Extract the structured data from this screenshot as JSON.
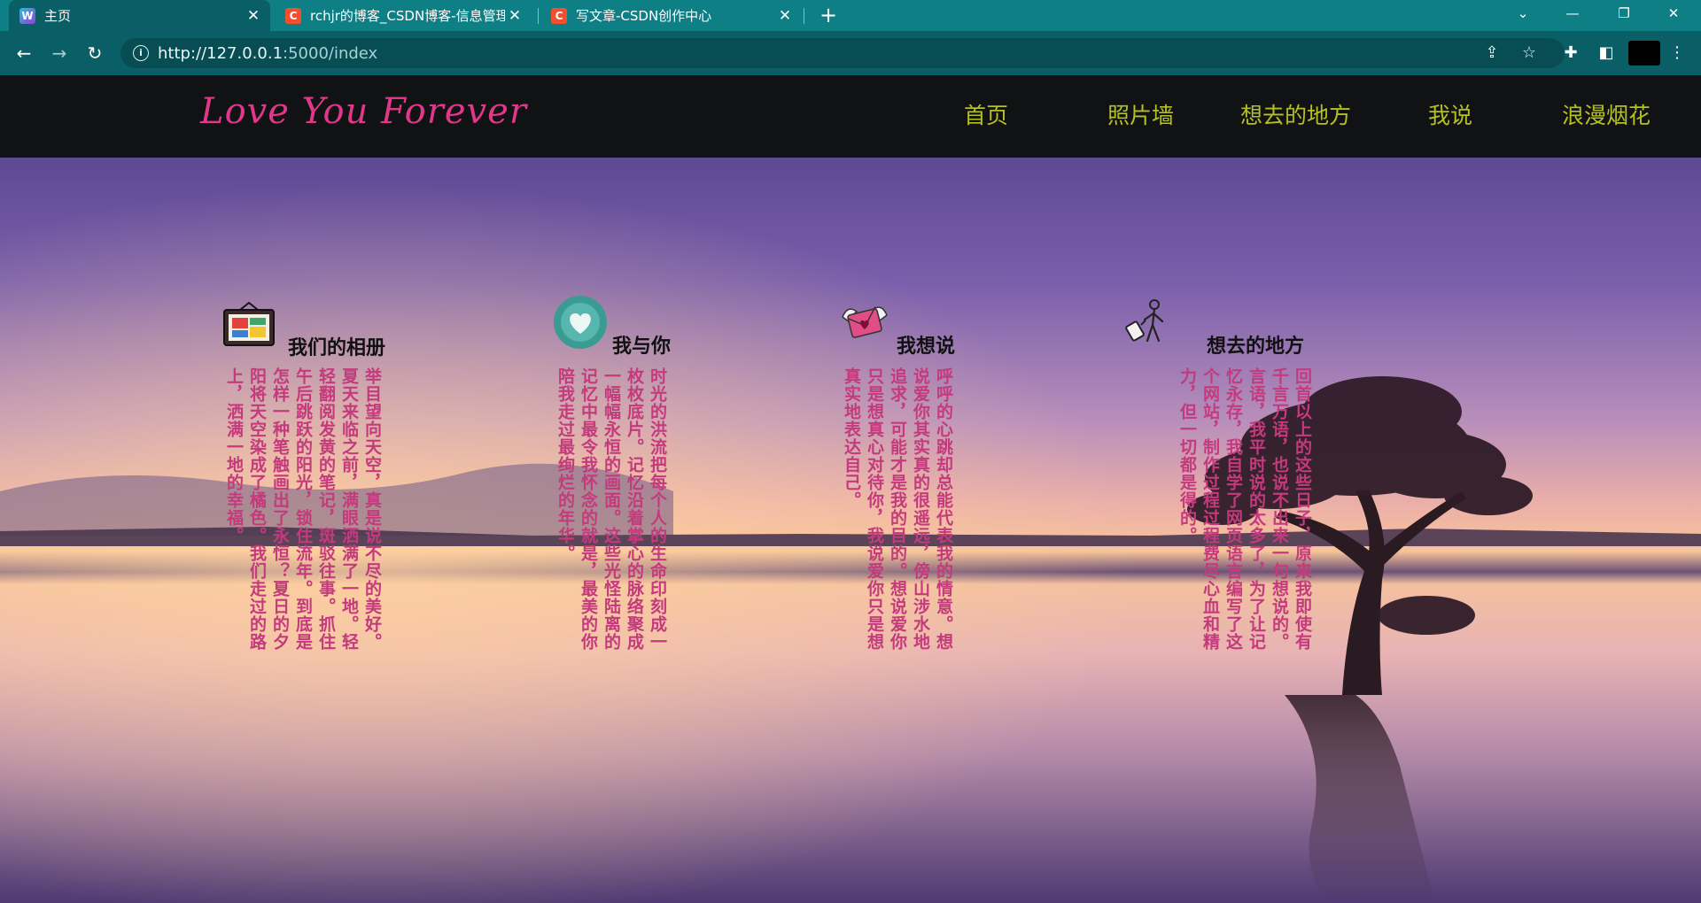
{
  "browser": {
    "tabs": [
      {
        "title": "主页",
        "favicon": "app-favicon",
        "active": true
      },
      {
        "title": "rchjr的博客_CSDN博客-信息管理",
        "favicon": "csdn-favicon",
        "active": false
      },
      {
        "title": "写文章-CSDN创作中心",
        "favicon": "csdn-favicon",
        "active": false
      }
    ],
    "favicon_letters": {
      "csdn": "C",
      "app": "W"
    },
    "url_host": "http://127.0.0.1",
    "url_rest": ":5000/index"
  },
  "site": {
    "logo": "Love You Forever",
    "nav": [
      "首页",
      "照片墙",
      "想去的地方",
      "我说",
      "浪漫烟花"
    ]
  },
  "cards": [
    {
      "icon": "photo-frame-icon",
      "title": "我们的相册",
      "text": "举目望向天空，真是说不尽的美好。夏天来临之前，满眼洒满了一地。轻轻翻阅发黄的笔记，斑驳往事。抓住午后跳跃的阳光，锁住流年。到底是怎样一种笔触画出了永恒？夏日的夕阳将天空染成了橘色。我们走过的路上，洒满一地的幸福。"
    },
    {
      "icon": "heart-badge-icon",
      "title": "我与你",
      "text": "时光的洪流把每个人的生命印刻成一枚枚底片。记忆沿着掌心的脉络聚成一幅幅永恒的画面。这些光怪陆离的记忆中最令我怀念的就是，最美的你陪我走过最绚烂的年华。"
    },
    {
      "icon": "love-letter-icon",
      "title": "我想说",
      "text": "呼呼的心跳却总能代表我的情意。想说爱你其实真的很遥远，傍山涉水地追求，可能才是我的目的。想说爱你只是想真心对待你，我说爱你只是想真实地表达自己。"
    },
    {
      "icon": "traveler-icon",
      "title": "想去的地方",
      "text": "回首以上的这些日子，原来我即使有千言万语，也说不出来一句想说的。言语，我平时说的太多了，为了让记忆永存，我自学了网页语言编写了这个网站，制作过程过程费尽心血和精力，但一切都是得的。"
    }
  ]
}
